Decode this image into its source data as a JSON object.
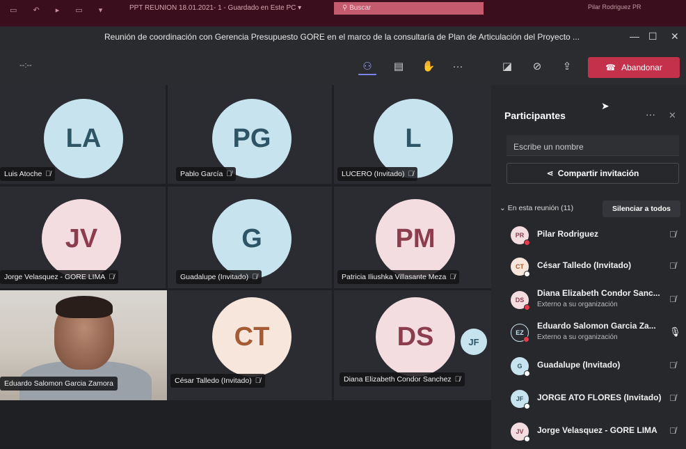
{
  "ppt": {
    "doc_title": "PPT REUNION 18.01.2021- 1  -  Guardado en Este PC  ▾",
    "search": "Buscar",
    "user": "Pilar Rodriguez   PR"
  },
  "window": {
    "title": "Reunión de coordinación con Gerencia Presupuesto GORE en el marco de la consultaría de Plan de Articulación del Proyecto ..."
  },
  "toolbar": {
    "timer": "--:--",
    "leave_label": "Abandonar"
  },
  "tiles": [
    {
      "initials": "LA",
      "name": "Luis Atoche"
    },
    {
      "initials": "PG",
      "name": "Pablo García"
    },
    {
      "initials": "L",
      "name": "LUCERO (Invitado)"
    },
    {
      "initials": "JV",
      "name": "Jorge Velasquez - GORE LIMA"
    },
    {
      "initials": "G",
      "name": "Guadalupe (Invitado)"
    },
    {
      "initials": "PM",
      "name": "Patricia Iliushka Villasante Meza"
    },
    {
      "initials": "",
      "name": "Eduardo Salomon Garcia Zamora"
    },
    {
      "initials": "CT",
      "name": "César Talledo (Invitado)"
    },
    {
      "initials": "DS",
      "name": "Diana Elizabeth Condor Sanchez"
    }
  ],
  "self_initials": "JF",
  "panel": {
    "title": "Participantes",
    "search_placeholder": "Escribe un nombre",
    "share_label": "Compartir invitación",
    "section_label": "En esta reunión (11)",
    "mute_all_label": "Silenciar a todos",
    "participants": [
      {
        "initials": "PR",
        "name": "Pilar Rodriguez",
        "sub": ""
      },
      {
        "initials": "CT",
        "name": "César Talledo (Invitado)",
        "sub": ""
      },
      {
        "initials": "DS",
        "name": "Diana Elizabeth Condor Sanc...",
        "sub": "Externo a su organización"
      },
      {
        "initials": "EZ",
        "name": "Eduardo Salomon Garcia Za...",
        "sub": "Externo a su organización"
      },
      {
        "initials": "G",
        "name": "Guadalupe (Invitado)",
        "sub": ""
      },
      {
        "initials": "JF",
        "name": "JORGE ATO FLORES (Invitado)",
        "sub": ""
      },
      {
        "initials": "JV",
        "name": "Jorge Velasquez - GORE LIMA",
        "sub": ""
      }
    ]
  },
  "colors": {
    "leave": "#c4314b",
    "accent": "#7b83eb"
  }
}
